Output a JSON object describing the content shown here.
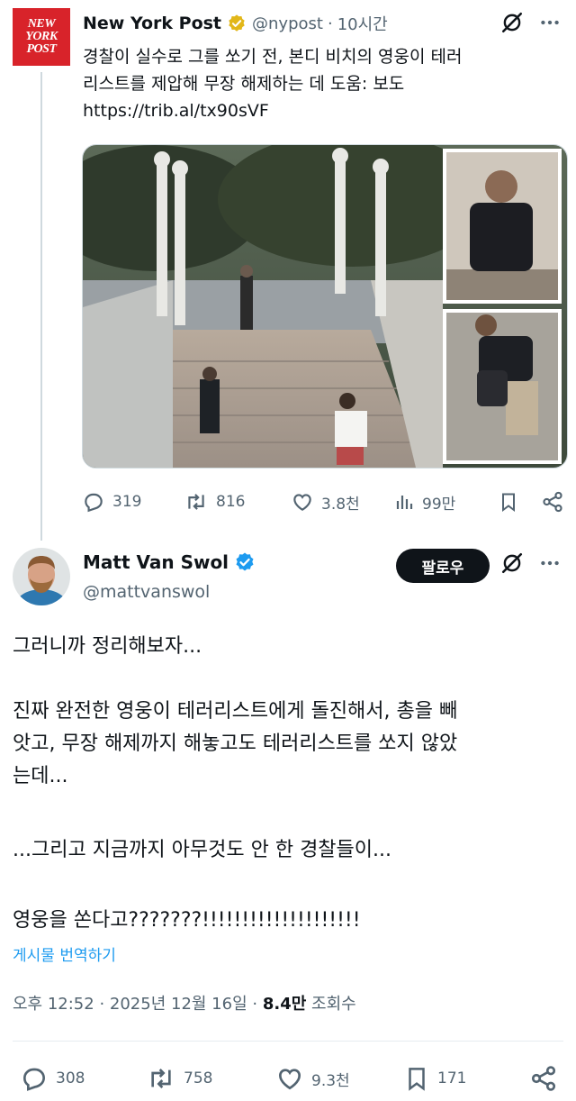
{
  "quoted_tweet": {
    "author_name": "New York Post",
    "handle": "@nypost",
    "separator": "·",
    "time": "10시간",
    "logo_text": [
      "NEW",
      "YORK",
      "POST"
    ],
    "text_line1": "경찰이 실수로 그를 쏘기 전, 본디 비치의 영웅이 테러",
    "text_line2": "리스트를 제압해 무장 해제하는 데 도움: 보도",
    "link": "https://trib.al/tx90sVF",
    "stats": {
      "replies": "319",
      "reposts": "816",
      "likes": "3.8천",
      "views": "99만"
    },
    "badge_color": "#e2b719"
  },
  "main_tweet": {
    "author_name": "Matt Van Swol",
    "handle": "@mattvanswol",
    "follow_label": "팔로우",
    "paragraphs": [
      [
        "그러니까 정리해보자..."
      ],
      [
        "진짜 완전한 영웅이 테러리스트에게 돌진해서, 총을 빼",
        "앗고, 무장 해제까지 해놓고도 테러리스트를 쏘지 않았",
        "는데..."
      ],
      [
        "...그리고 지금까지 아무것도 안 한 경찰들이..."
      ],
      [
        "영웅을 쏜다고???????!!!!!!!!!!!!!!!!!!!!"
      ]
    ],
    "translate_label": "게시물 번역하기",
    "time": "오후 12:52",
    "date": "2025년 12월 16일",
    "views_count": "8.4만",
    "views_label": "조회수",
    "stats": {
      "replies": "308",
      "reposts": "758",
      "likes": "9.3천",
      "bookmarks": "171"
    },
    "badge_color": "#1d9bf0"
  },
  "icons": {
    "grok": "grok-icon",
    "more": "more-icon",
    "reply": "reply-icon",
    "repost": "repost-icon",
    "like": "like-icon",
    "views": "views-icon",
    "bookmark": "bookmark-icon",
    "share": "share-icon"
  }
}
